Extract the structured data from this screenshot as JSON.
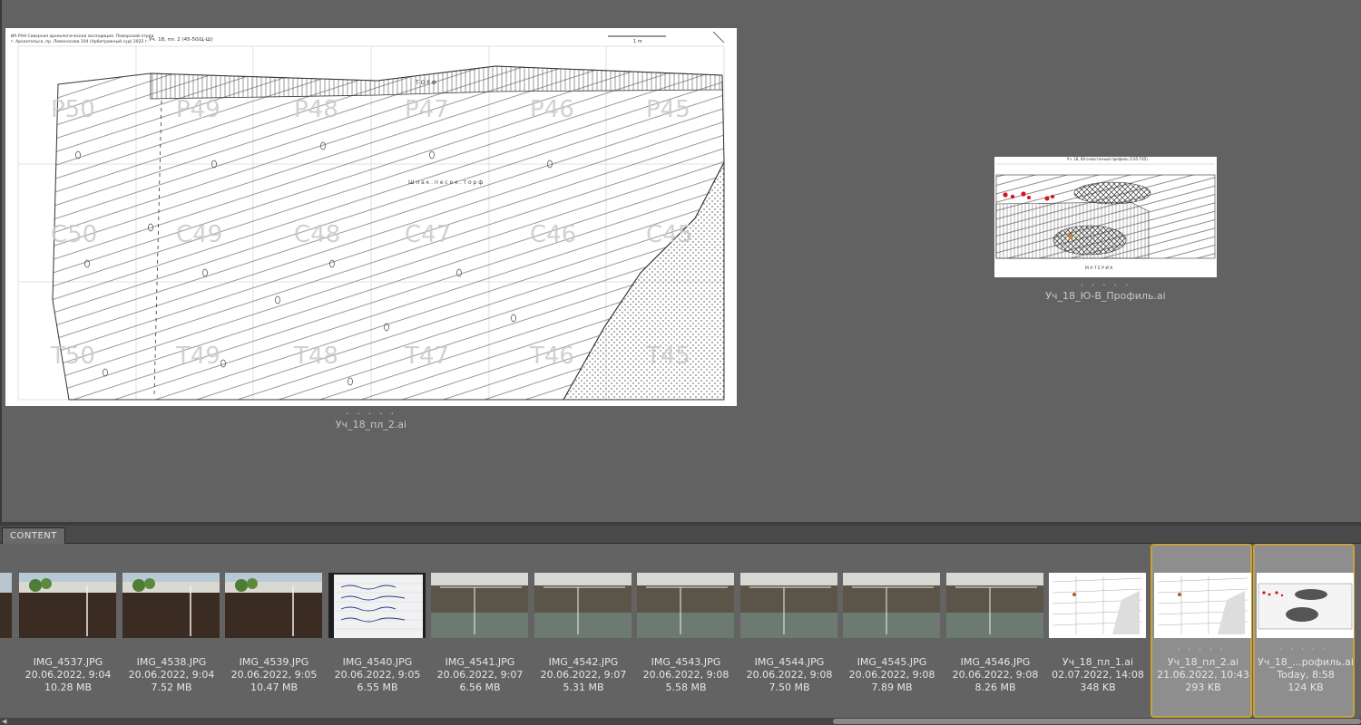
{
  "preview": {
    "primary": {
      "name": "Уч_18_пл_2.ai",
      "dots": ". . . . .",
      "header_line1": "ИА РАН Северная археологическая экспедиция. Поморский отряд",
      "header_line2": "г. Архангельск, пр. Ломоносова 104 (Арбитражный суд) 2022 г.",
      "title": "Уч. 18, пл. 2 (45-50/Ц-Ш)",
      "scale": "1 m",
      "layer_peat": "Т О Р Ф",
      "layer_mix": "Ш л а к . п е с о к . т о р ф",
      "grid_labels": [
        "P50",
        "P49",
        "P48",
        "P47",
        "P46",
        "P45",
        "C50",
        "C49",
        "C48",
        "C47",
        "C46",
        "C45",
        "T50",
        "T49",
        "T48",
        "T47",
        "T46",
        "T45"
      ]
    },
    "secondary": {
      "name": "Уч_18_Ю-В_Профиль.ai",
      "dots": ". . . . .",
      "title": "Уч. 18, Юго-восточный профиль (С45-Т45)",
      "layer": "М А Т Е Р И К"
    }
  },
  "content_panel": {
    "tab_label": "CONTENT"
  },
  "thumbnails": [
    {
      "name": "IMG_4537.JPG",
      "date": "20.06.2022, 9:04",
      "size": "10.28 MB",
      "kind": "site_trees"
    },
    {
      "name": "IMG_4538.JPG",
      "date": "20.06.2022, 9:04",
      "size": "7.52 MB",
      "kind": "site_trees"
    },
    {
      "name": "IMG_4539.JPG",
      "date": "20.06.2022, 9:05",
      "size": "10.47 MB",
      "kind": "site_trees"
    },
    {
      "name": "IMG_4540.JPG",
      "date": "20.06.2022, 9:05",
      "size": "6.55 MB",
      "kind": "notebook"
    },
    {
      "name": "IMG_4541.JPG",
      "date": "20.06.2022, 9:07",
      "size": "6.56 MB",
      "kind": "trench"
    },
    {
      "name": "IMG_4542.JPG",
      "date": "20.06.2022, 9:07",
      "size": "5.31 MB",
      "kind": "trench"
    },
    {
      "name": "IMG_4543.JPG",
      "date": "20.06.2022, 9:08",
      "size": "5.58 MB",
      "kind": "trench"
    },
    {
      "name": "IMG_4544.JPG",
      "date": "20.06.2022, 9:08",
      "size": "7.50 MB",
      "kind": "trench"
    },
    {
      "name": "IMG_4545.JPG",
      "date": "20.06.2022, 9:08",
      "size": "7.89 MB",
      "kind": "trench"
    },
    {
      "name": "IMG_4546.JPG",
      "date": "20.06.2022, 9:08",
      "size": "8.26 MB",
      "kind": "trench"
    },
    {
      "name": "Уч_18_пл_1.ai",
      "date": "02.07.2022, 14:08",
      "size": "348 KB",
      "kind": "plan"
    },
    {
      "name": "Уч_18_пл_2.ai",
      "date": "21.06.2022, 10:43",
      "size": "293 KB",
      "kind": "plan",
      "selected": true
    },
    {
      "name": "Уч_18_...рофиль.ai",
      "date": "Today, 8:58",
      "size": "124 KB",
      "kind": "profile",
      "selected": true
    }
  ],
  "selection_dots": ". . . . .",
  "colors": {
    "accent": "#c8a13a",
    "panel_bg": "#636363",
    "preview_bg": "#626262"
  }
}
